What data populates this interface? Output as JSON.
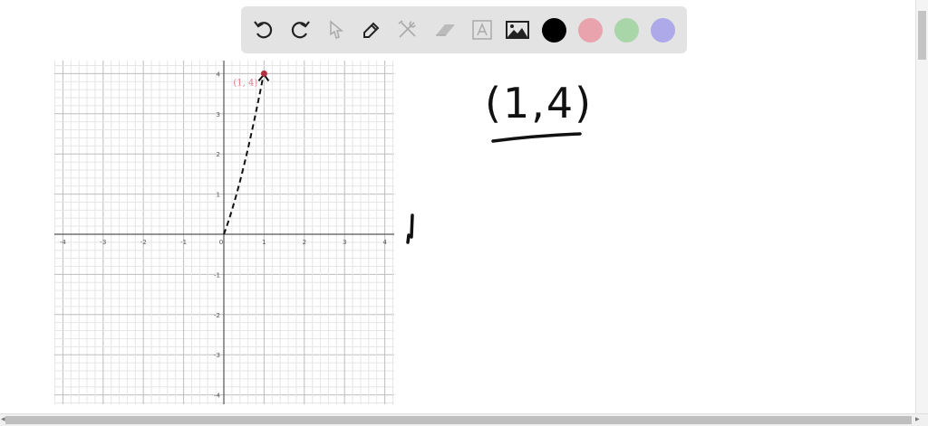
{
  "toolbar": {
    "tools": [
      "undo-icon",
      "redo-icon",
      "select-icon",
      "pen-icon",
      "tools-icon",
      "eraser-icon",
      "text-icon",
      "image-icon"
    ],
    "colors": [
      "#000000",
      "#e8a3ad",
      "#a9d6a9",
      "#aeaaea"
    ]
  },
  "graph": {
    "xlim": [
      -4,
      4
    ],
    "ylim": [
      -4,
      4
    ],
    "x_ticks": [
      "-4",
      "-3",
      "-2",
      "-1",
      "0",
      "1",
      "2",
      "3",
      "4"
    ],
    "y_ticks": [
      "-4",
      "-3",
      "-2",
      "-1",
      "1",
      "2",
      "3",
      "4"
    ],
    "point": {
      "x": 1,
      "y": 4,
      "label": "(1, 4)",
      "color": "#b03040"
    },
    "dashed_curve": {
      "from": [
        0,
        0
      ],
      "to": [
        1,
        4
      ]
    }
  },
  "handwriting": {
    "answer": "(1,4)"
  }
}
